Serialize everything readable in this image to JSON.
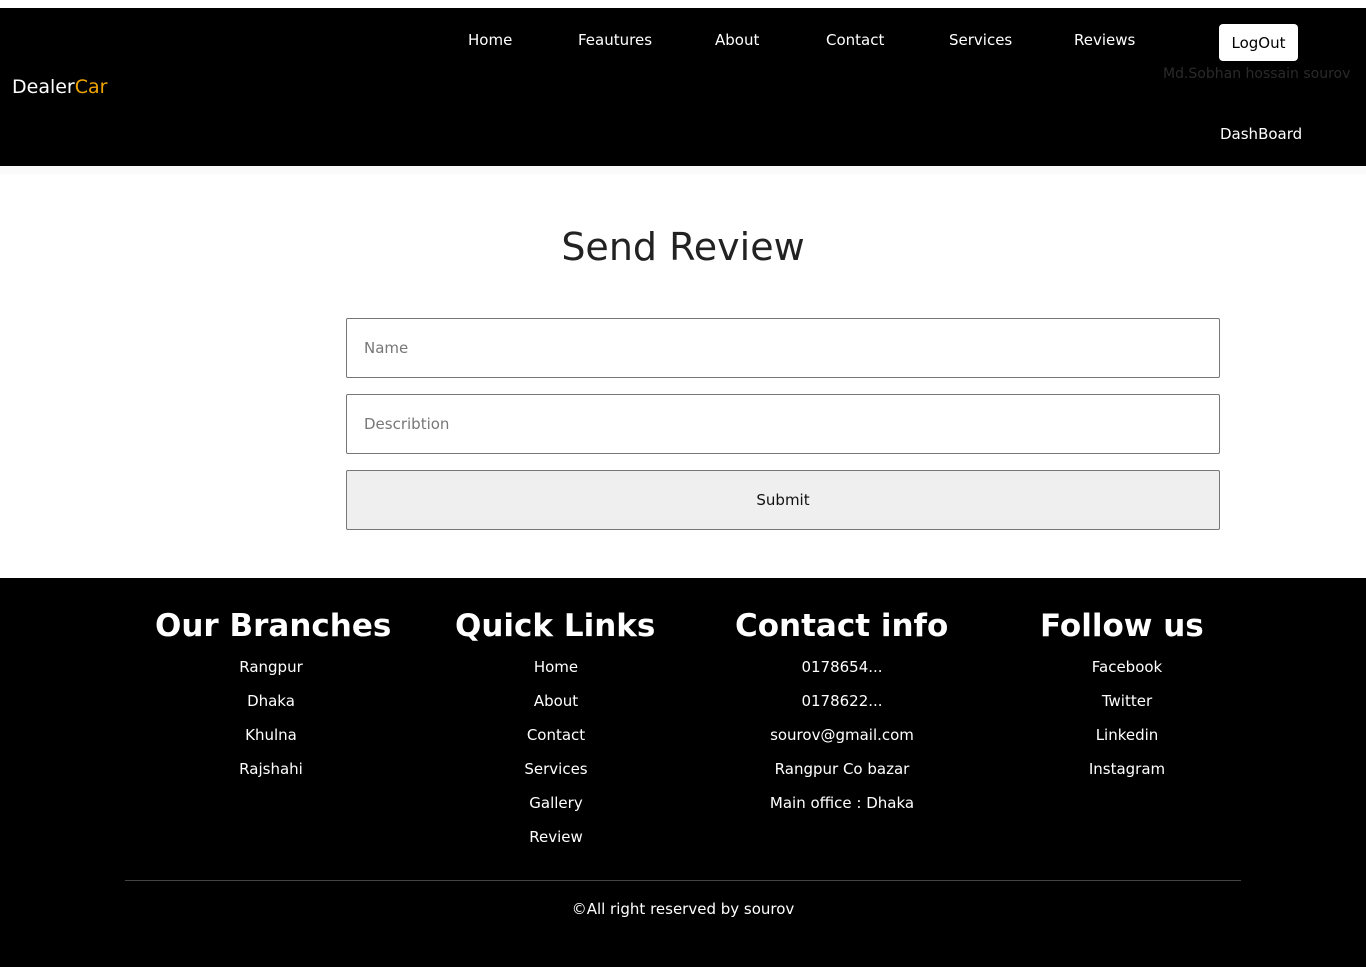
{
  "brand": {
    "part1": "Dealer",
    "part2": "Car",
    "accent_color": "#f0a500"
  },
  "nav": {
    "links": [
      "Home",
      "Feautures",
      "About",
      "Contact",
      "Services",
      "Reviews"
    ],
    "logout_label": "LogOut",
    "username": "Md.Sobhan hossain sourov",
    "dashboard_label": "DashBoard"
  },
  "review": {
    "title": "Send Review",
    "name_placeholder": "Name",
    "name_value": "",
    "description_placeholder": "Describtion",
    "description_value": "",
    "submit_label": "Submit"
  },
  "footer": {
    "branches": {
      "title": "Our Branches",
      "items": [
        "Rangpur",
        "Dhaka",
        "Khulna",
        "Rajshahi"
      ]
    },
    "quick_links": {
      "title": "Quick Links",
      "items": [
        "Home",
        "About",
        "Contact",
        "Services",
        "Gallery",
        "Review"
      ]
    },
    "contact": {
      "title": "Contact info",
      "items": [
        "0178654...",
        "0178622...",
        "sourov@gmail.com",
        "Rangpur Co bazar",
        "Main office : Dhaka"
      ]
    },
    "follow": {
      "title": "Follow us",
      "items": [
        "Facebook",
        "Twitter",
        "Linkedin",
        "Instagram"
      ]
    },
    "copyright": "©All right reserved by sourov"
  }
}
